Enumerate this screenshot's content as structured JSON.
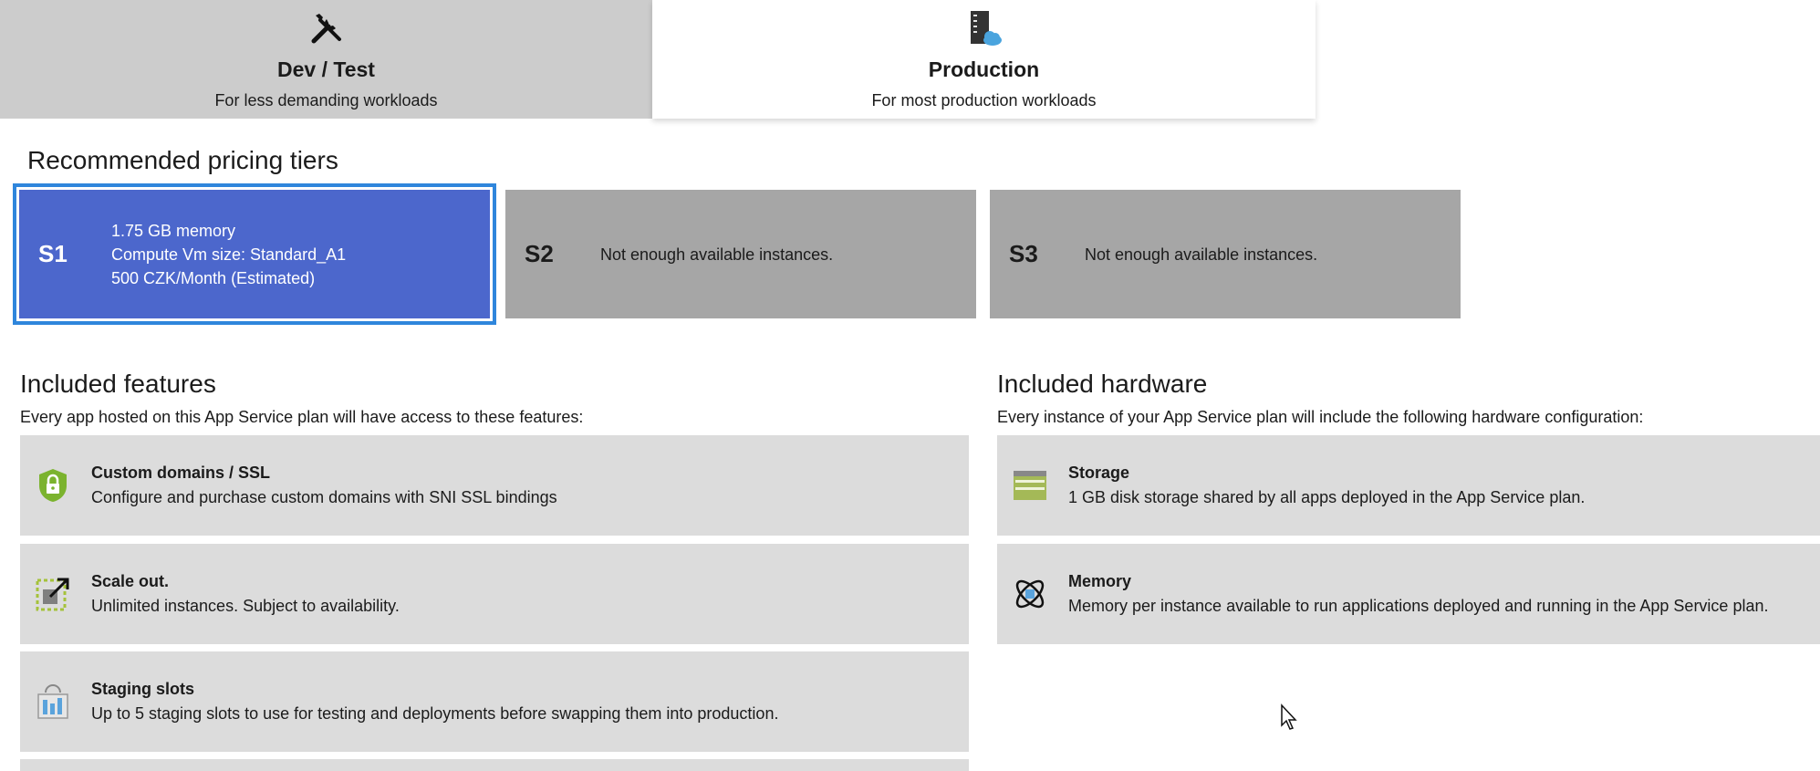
{
  "tabs": [
    {
      "title": "Dev / Test",
      "subtitle": "For less demanding workloads",
      "icon": "tools-icon",
      "selected": false
    },
    {
      "title": "Production",
      "subtitle": "For most production workloads",
      "icon": "server-cloud-icon",
      "selected": true
    }
  ],
  "recommended": {
    "title": "Recommended pricing tiers",
    "tiers": [
      {
        "name": "S1",
        "lines": [
          "1.75 GB memory",
          "Compute Vm size: Standard_A1",
          "500 CZK/Month (Estimated)"
        ],
        "selected": true
      },
      {
        "name": "S2",
        "message": "Not enough available instances.",
        "available": false
      },
      {
        "name": "S3",
        "message": "Not enough available instances.",
        "available": false
      }
    ]
  },
  "features": {
    "title": "Included features",
    "description": "Every app hosted on this App Service plan will have access to these features:",
    "items": [
      {
        "title": "Custom domains / SSL",
        "text": "Configure and purchase custom domains with SNI SSL bindings",
        "icon": "shield-lock-icon"
      },
      {
        "title": "Scale out.",
        "text": "Unlimited instances. Subject to availability.",
        "icon": "scale-out-icon"
      },
      {
        "title": "Staging slots",
        "text": "Up to 5 staging slots to use for testing and deployments before swapping them into production.",
        "icon": "staging-slots-icon"
      }
    ]
  },
  "hardware": {
    "title": "Included hardware",
    "description": "Every instance of your App Service plan will include the following hardware configuration:",
    "items": [
      {
        "title": "Storage",
        "text": "1 GB disk storage shared by all apps deployed in the App Service plan.",
        "icon": "storage-icon"
      },
      {
        "title": "Memory",
        "text": "Memory per instance available to run applications deployed and running in the App Service plan.",
        "icon": "memory-icon"
      }
    ]
  },
  "colors": {
    "selected_tier": "#4c67cc",
    "selected_border": "#2f86dc",
    "unavailable_tier": "#a6a6a6",
    "card_bg": "#dcdcdc",
    "tab_inactive": "#cccccc"
  }
}
